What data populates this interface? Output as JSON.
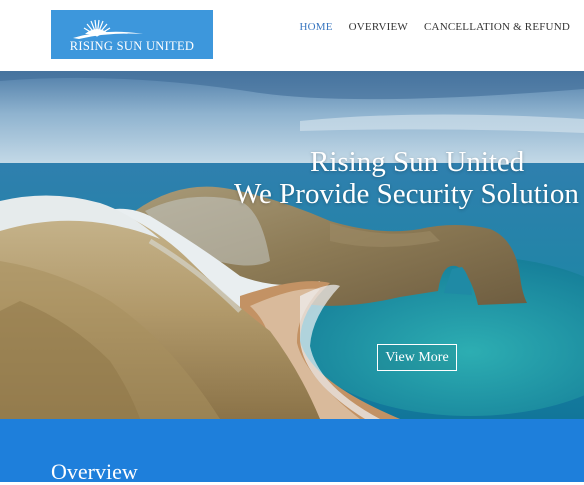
{
  "header": {
    "logo_text": "RISING SUN UNITED",
    "nav": [
      {
        "label": "HOME",
        "active": true
      },
      {
        "label": "OVERVIEW",
        "active": false
      },
      {
        "label": "CANCELLATION & REFUND",
        "active": false
      }
    ]
  },
  "hero": {
    "title": "Rising Sun United",
    "subtitle": "We Provide Security Solution",
    "button_label": "View More"
  },
  "overview": {
    "title": "Overview"
  },
  "colors": {
    "brand_blue": "#3d97dc",
    "overview_band": "#1e7fdb",
    "nav_active": "#3a77c0"
  }
}
